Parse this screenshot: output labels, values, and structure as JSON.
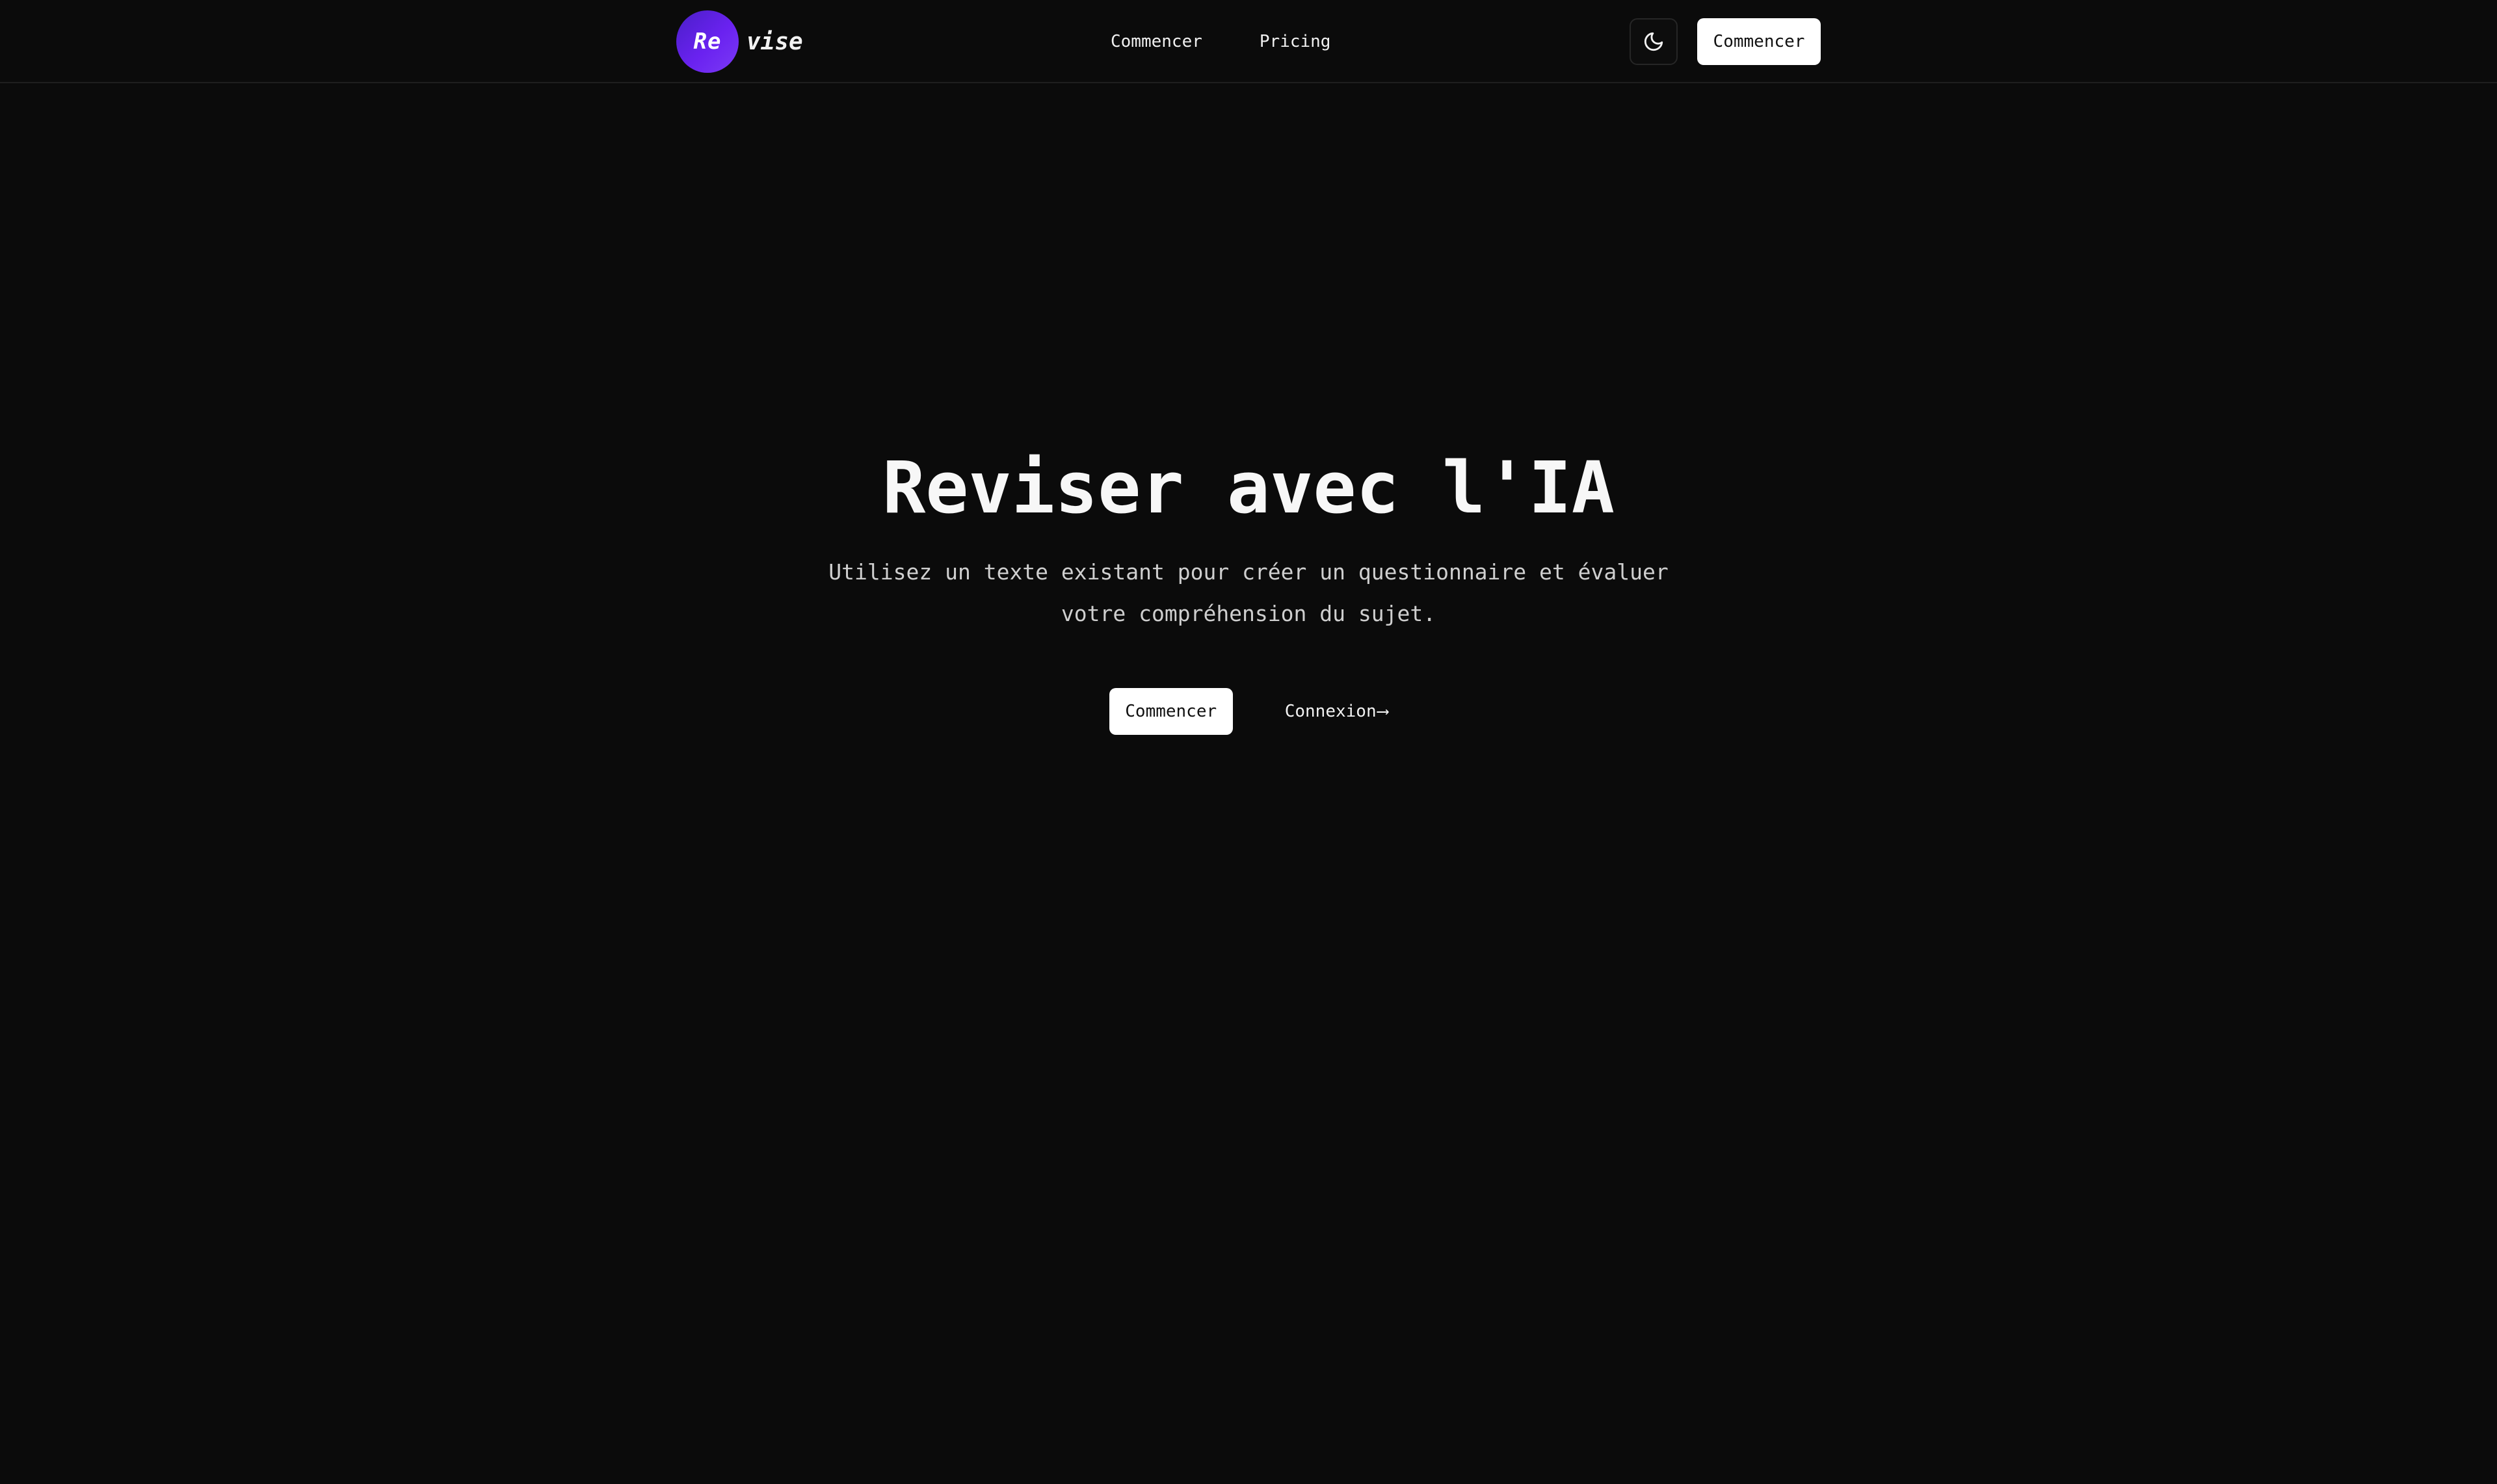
{
  "header": {
    "logo": {
      "circle_text": "Re",
      "rest_text": "vise",
      "gradient_colors": [
        "#4a1fc8",
        "#7b3af5"
      ]
    },
    "nav": [
      {
        "label": "Commencer"
      },
      {
        "label": "Pricing"
      }
    ],
    "theme_toggle_icon": "moon-icon",
    "cta_label": "Commencer"
  },
  "hero": {
    "title": "Reviser avec l'IA",
    "subtitle": "Utilisez un texte existant pour créer un questionnaire et évaluer votre compréhension du sujet.",
    "primary_label": "Commencer",
    "secondary_label": "Connexion",
    "secondary_arrow": "⟶"
  },
  "colors": {
    "background": "#0b0b0b",
    "button_bg": "#ffffff",
    "button_text": "#111111"
  }
}
